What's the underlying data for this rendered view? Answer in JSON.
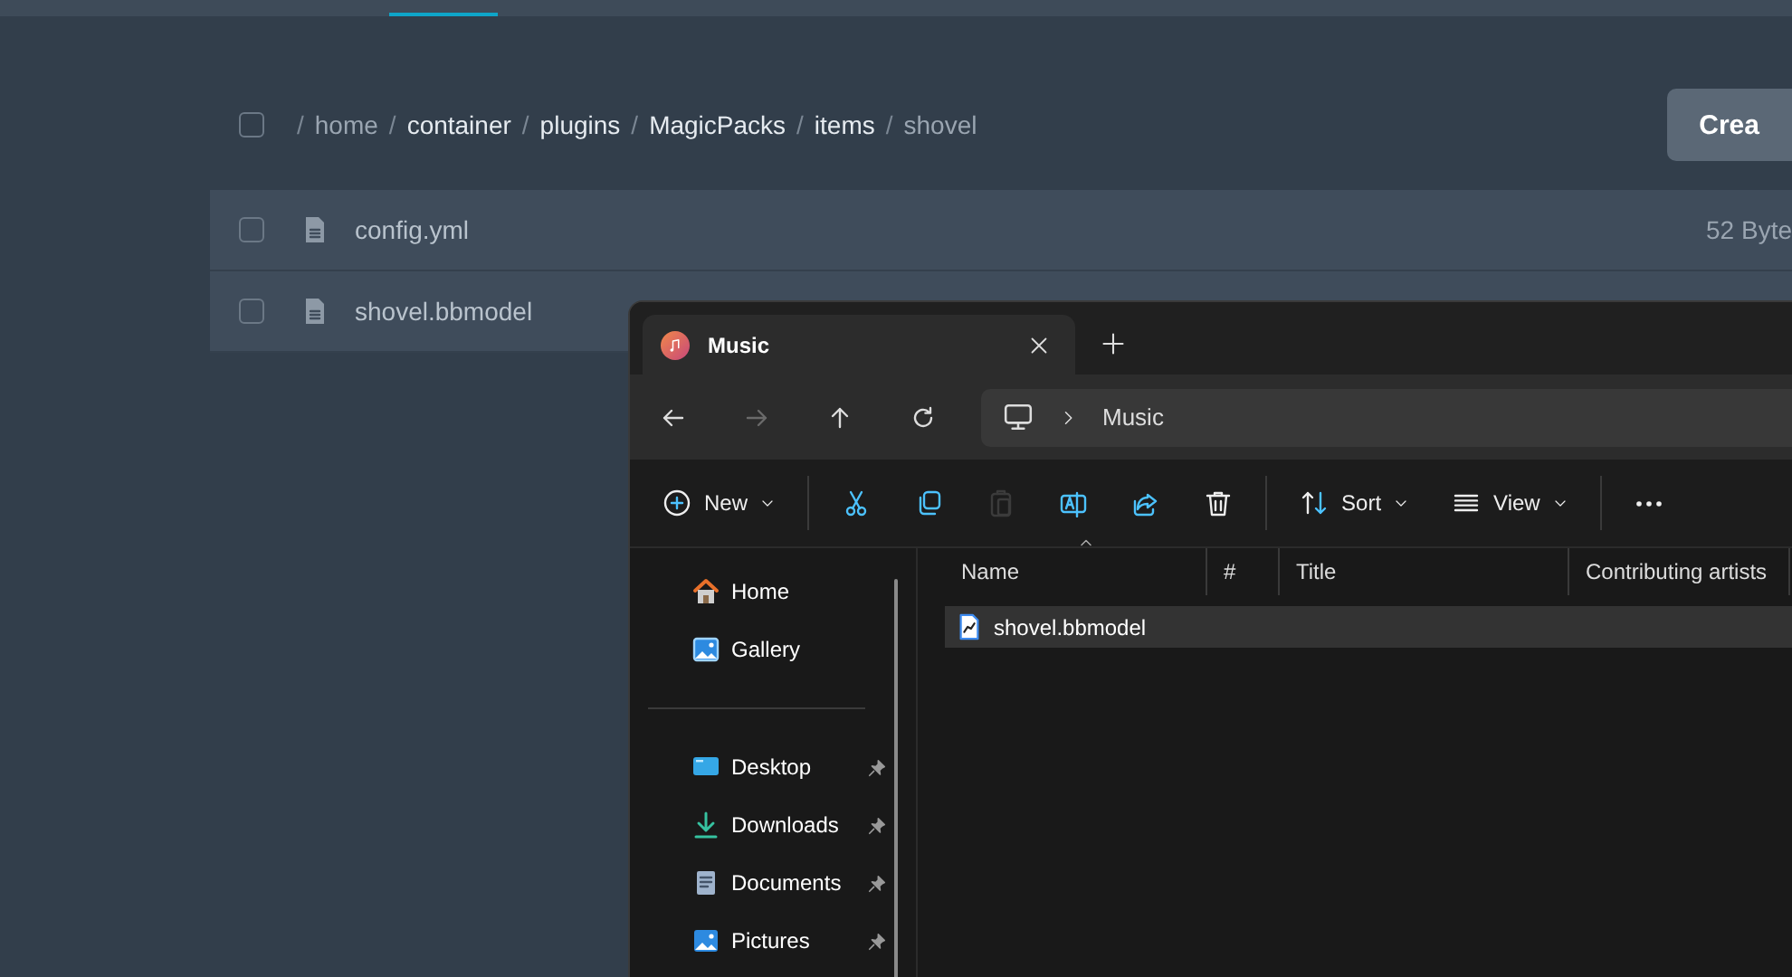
{
  "breadcrumb": {
    "checked": false,
    "parts": [
      {
        "sep": "/",
        "label": "home",
        "muted": true
      },
      {
        "sep": "/",
        "label": "container",
        "muted": false
      },
      {
        "sep": "/",
        "label": "plugins",
        "muted": false
      },
      {
        "sep": "/",
        "label": "MagicPacks",
        "muted": false
      },
      {
        "sep": "/",
        "label": "items",
        "muted": false
      },
      {
        "sep": "/",
        "label": "shovel",
        "muted": true
      }
    ]
  },
  "create_button": "Crea",
  "files": [
    {
      "name": "config.yml",
      "size": "52 Byte",
      "checked": false
    },
    {
      "name": "shovel.bbmodel",
      "checked": false
    }
  ],
  "explorer": {
    "tab": {
      "title": "Music"
    },
    "nav": [
      {
        "kind": "back",
        "disabled": false
      },
      {
        "kind": "forward",
        "disabled": true
      },
      {
        "kind": "up",
        "disabled": false
      },
      {
        "kind": "refresh",
        "disabled": false
      }
    ],
    "address": "Music",
    "toolbar": [
      {
        "kind": "new",
        "label": "New",
        "disabled": false
      },
      {
        "kind": "cut",
        "disabled": false
      },
      {
        "kind": "copy",
        "disabled": false
      },
      {
        "kind": "paste",
        "disabled": true
      },
      {
        "kind": "rename",
        "disabled": false
      },
      {
        "kind": "share",
        "disabled": false
      },
      {
        "kind": "delete",
        "disabled": false
      },
      {
        "kind": "sort",
        "label": "Sort",
        "disabled": false
      },
      {
        "kind": "view",
        "label": "View",
        "disabled": false
      },
      {
        "kind": "more",
        "disabled": false
      }
    ],
    "sidebar": [
      {
        "kind": "home",
        "label": "Home",
        "pinned": false
      },
      {
        "kind": "gallery",
        "label": "Gallery",
        "pinned": false
      },
      {
        "kind": "separator"
      },
      {
        "kind": "desktop",
        "label": "Desktop",
        "pinned": true
      },
      {
        "kind": "downloads",
        "label": "Downloads",
        "pinned": true
      },
      {
        "kind": "documents",
        "label": "Documents",
        "pinned": true
      },
      {
        "kind": "pictures",
        "label": "Pictures",
        "pinned": true
      }
    ],
    "columns": [
      "Name",
      "#",
      "Title",
      "Contributing artists"
    ],
    "rows": [
      {
        "name": "shovel.bbmodel",
        "selected": true
      }
    ]
  }
}
